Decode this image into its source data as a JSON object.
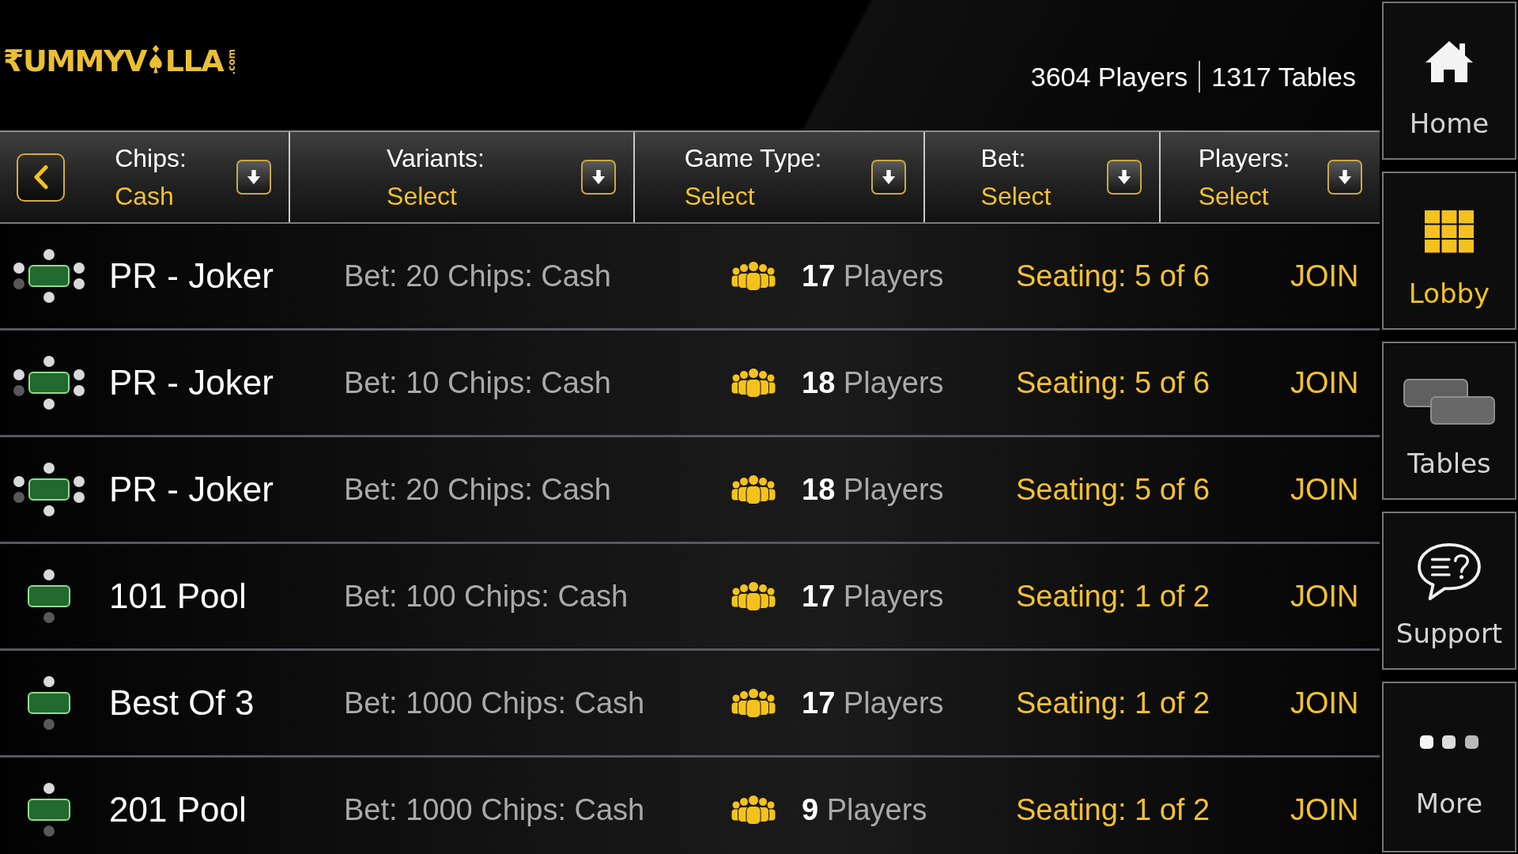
{
  "logo": {
    "text_before": "₹UMMYV",
    "text_after": "LLA",
    "domain": ".com"
  },
  "stats": [
    "3604 Players",
    "1317 Tables"
  ],
  "filters": [
    {
      "label": "Chips:",
      "value": "Cash"
    },
    {
      "label": "Variants:",
      "value": "Select"
    },
    {
      "label": "Game Type:",
      "value": "Select"
    },
    {
      "label": "Bet:",
      "value": "Select"
    },
    {
      "label": "Players:",
      "value": "Select"
    }
  ],
  "games": [
    {
      "name": "PR - Joker",
      "bet": "Bet: 20 Chips: Cash",
      "players": "**17** Players",
      "seating": "Seating: 5 of 6",
      "action": "JOIN",
      "seats": [
        {
          "occupied": true
        },
        {
          "occupied": true
        },
        {
          "occupied": true
        },
        {
          "occupied": true
        },
        {
          "occupied": false
        },
        {
          "occupied": true
        }
      ]
    },
    {
      "name": "PR - Joker",
      "bet": "Bet: 10 Chips: Cash",
      "players": "**18** Players",
      "seating": "Seating: 5 of 6",
      "action": "JOIN",
      "seats": [
        {
          "occupied": true
        },
        {
          "occupied": true
        },
        {
          "occupied": true
        },
        {
          "occupied": true
        },
        {
          "occupied": false
        },
        {
          "occupied": true
        }
      ]
    },
    {
      "name": "PR - Joker",
      "bet": "Bet: 20 Chips: Cash",
      "players": "**18** Players",
      "seating": "Seating: 5 of 6",
      "action": "JOIN",
      "seats": [
        {
          "occupied": true
        },
        {
          "occupied": true
        },
        {
          "occupied": true
        },
        {
          "occupied": true
        },
        {
          "occupied": false
        },
        {
          "occupied": true
        }
      ]
    },
    {
      "name": "101 Pool",
      "bet": "Bet: 100 Chips: Cash",
      "players": "**17** Players",
      "seating": "Seating: 1 of 2",
      "action": "JOIN",
      "seats": [
        {
          "occupied": true
        },
        {
          "occupied": false
        }
      ]
    },
    {
      "name": "Best Of 3",
      "bet": "Bet: 1000 Chips: Cash",
      "players": "**17** Players",
      "seating": "Seating: 1 of 2",
      "action": "JOIN",
      "seats": [
        {
          "occupied": true
        },
        {
          "occupied": false
        }
      ]
    },
    {
      "name": "201 Pool",
      "bet": "Bet: 1000 Chips: Cash",
      "players": "**9** Players",
      "seating": "Seating: 1 of 2",
      "action": "JOIN",
      "seats": [
        {
          "occupied": true
        },
        {
          "occupied": false
        }
      ]
    }
  ],
  "sidebar": {
    "items": [
      {
        "kind": "home",
        "label": "Home",
        "selected": false
      },
      {
        "kind": "grid",
        "label": "Lobby",
        "selected": true
      },
      {
        "kind": "tables",
        "label": "Tables",
        "selected": false
      },
      {
        "kind": "support",
        "label": "Support",
        "selected": false
      },
      {
        "kind": "more",
        "label": "More",
        "selected": false
      }
    ]
  }
}
